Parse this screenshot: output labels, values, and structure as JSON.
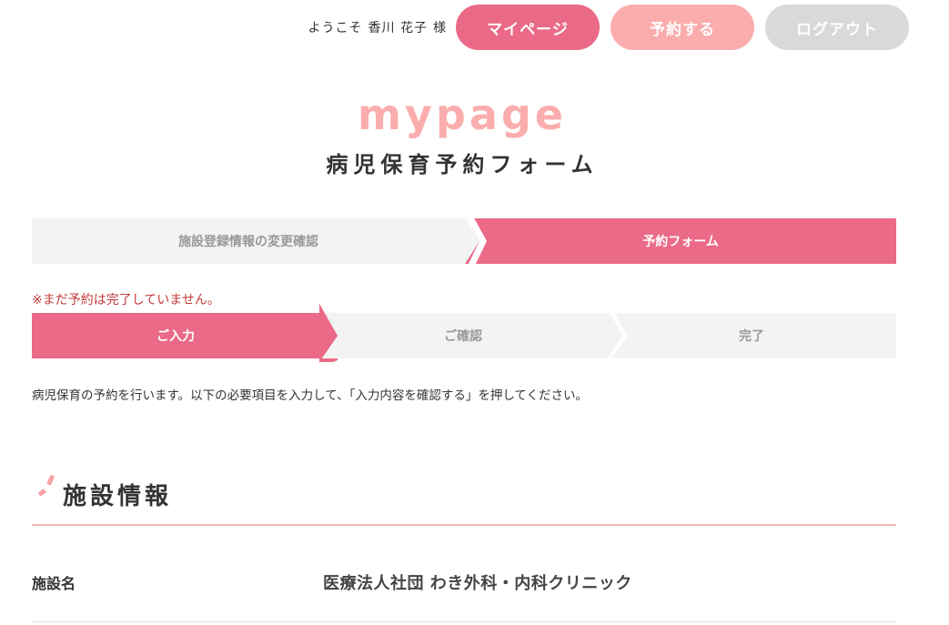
{
  "header": {
    "welcome_prefix": "ようこそ",
    "user_name": "香川 花子",
    "honorific": "様",
    "buttons": {
      "mypage": "マイページ",
      "reserve": "予約する",
      "logout": "ログアウト"
    }
  },
  "title": {
    "en": "mypage",
    "jp": "病児保育予約フォーム"
  },
  "steps_main": [
    {
      "label": "施設登録情報の変更確認",
      "active": false
    },
    {
      "label": "予約フォーム",
      "active": true
    }
  ],
  "notice": "※まだ予約は完了していません。",
  "steps_sub": [
    {
      "label": "ご入力",
      "active": true
    },
    {
      "label": "ご確認",
      "active": false
    },
    {
      "label": "完了",
      "active": false
    }
  ],
  "description": "病児保育の予約を行います。以下の必要項目を入力して、「入力内容を確認する」を押してください。",
  "section": {
    "title": "施設情報",
    "rows": [
      {
        "label": "施設名",
        "value": "医療法人社団 わき外科・内科クリニック"
      }
    ]
  },
  "colors": {
    "accent": "#ea6a87",
    "accent_light": "#fbadad",
    "inactive": "#d9d9d9",
    "step_bg": "#f3f3f3",
    "notice": "#c43a3a",
    "divider": "#f4b7b0"
  }
}
